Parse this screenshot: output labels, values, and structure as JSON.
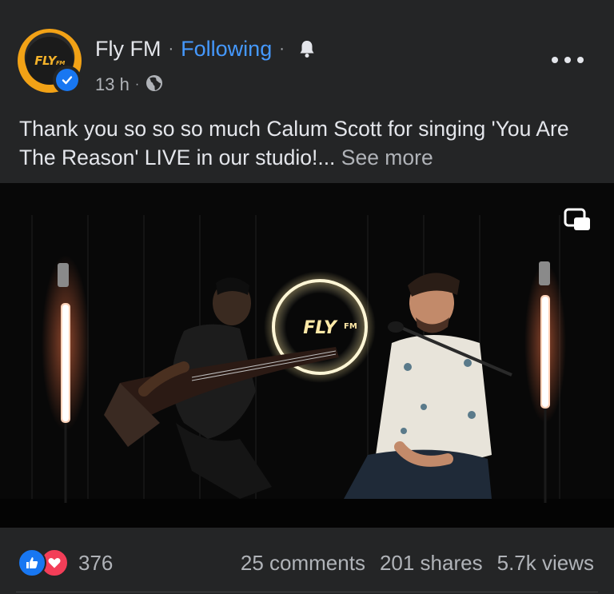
{
  "post": {
    "page_name": "Fly FM",
    "separator": "·",
    "follow_status": "Following",
    "timestamp": "13 h",
    "audience_icon": "globe-icon",
    "text": "Thank you so so so much Calum Scott for singing 'You Are The Reason' LIVE in our studio!...",
    "see_more": "See more"
  },
  "avatar": {
    "logo_text": "FLY",
    "logo_sub": "FM"
  },
  "video": {
    "neon_sign": "FLY",
    "neon_sign_sub": "FM",
    "pip_icon": "picture-in-picture-icon"
  },
  "engagement": {
    "reaction_count": "376",
    "comments": "25 comments",
    "shares": "201 shares",
    "views": "5.7k views"
  },
  "colors": {
    "background": "#242526",
    "accent_blue": "#4599ff",
    "like_blue": "#1877f2",
    "love_red": "#f33e58",
    "brand_orange": "#f2a216"
  }
}
